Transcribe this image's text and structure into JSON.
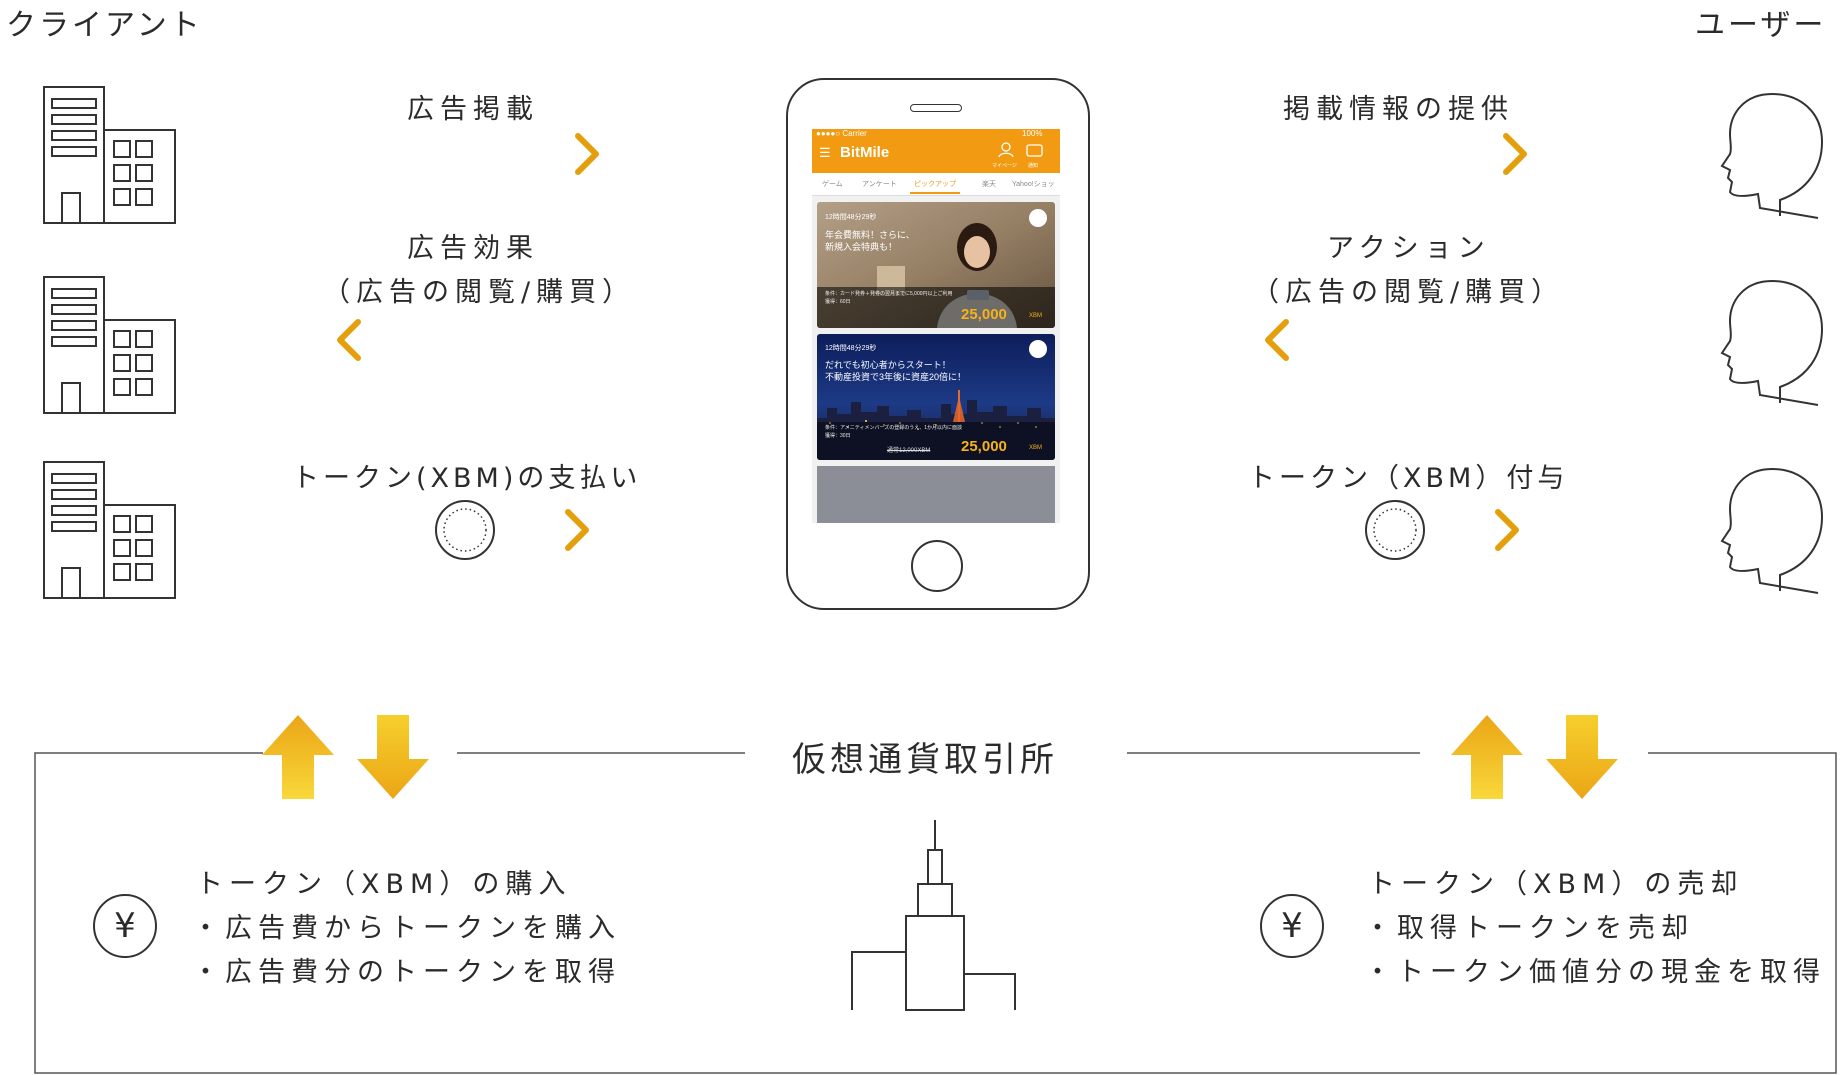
{
  "headers": {
    "client": "クライアント",
    "user": "ユーザー"
  },
  "left_flows": {
    "ad_placement": "広告掲載",
    "ad_effect": "広告効果",
    "ad_effect_detail": "（広告の閲覧/購買）",
    "token_payment": "トークン(XBM)の支払い"
  },
  "right_flows": {
    "info_provision": "掲載情報の提供",
    "action": "アクション",
    "action_detail": "（広告の閲覧/購買）",
    "token_grant": "トークン（XBM）付与"
  },
  "phone": {
    "status_carrier": "●●●●○ Carrier",
    "status_battery": "100%",
    "app_name": "BitMile",
    "header_icon_labels": [
      "マイページ",
      "通知"
    ],
    "tabs": [
      "ゲーム",
      "アンケート",
      "ピックアップ",
      "楽天",
      "Yahoo!ショッ"
    ],
    "active_tab": "ピックアップ",
    "cards": [
      {
        "timer": "12時間48分29秒",
        "headline_line1": "年会費無料！さらに、",
        "headline_line2": "新規入会特典も！",
        "condition": "条件：カード発券＋発券の翌月までに5,000円以上ご利用",
        "period": "獲得：60日",
        "points": "25,000",
        "unit": "XBM"
      },
      {
        "timer": "12時間48分29秒",
        "headline_line1": "だれでも初心者からスタート！",
        "headline_line2": "不動産投資で3年後に資産20倍に！",
        "condition": "条件：アメニティメンバーズの登録のうえ、1か月以内に面談",
        "period": "獲得：30日",
        "old_points": "通常12,000XBM",
        "points": "25,000",
        "unit": "XBM"
      }
    ]
  },
  "exchange": {
    "title": "仮想通貨取引所",
    "currency_symbol": "¥",
    "left_heading": "トークン（XBM）の購入",
    "left_items": [
      "・広告費からトークンを購入",
      "・広告費分のトークンを取得"
    ],
    "right_heading": "トークン（XBM）の売却",
    "right_items": [
      "・取得トークンを売却",
      "・トークン価値分の現金を取得"
    ]
  },
  "colors": {
    "gold_light": "#f6cf3a",
    "gold_dark": "#e3a20f",
    "app_orange": "#f19a12",
    "line": "#333333"
  }
}
